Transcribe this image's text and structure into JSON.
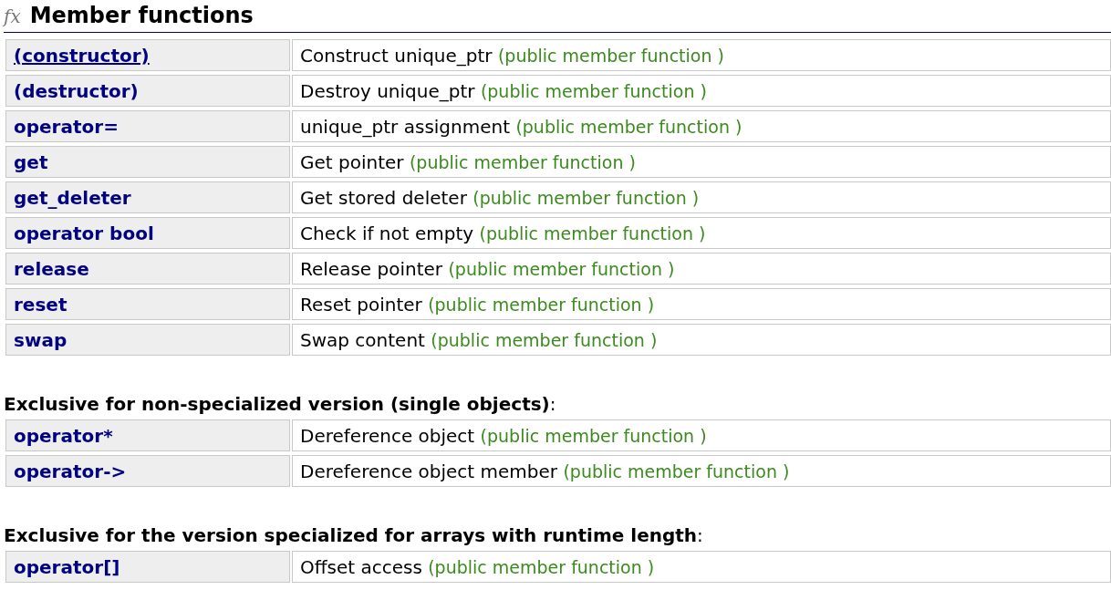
{
  "title_icon": "fx",
  "title": "Member functions",
  "sections": [
    {
      "rows": [
        {
          "name": "(constructor)",
          "underlined": true,
          "description": "Construct unique_ptr",
          "note": "(public member function )"
        },
        {
          "name": "(destructor)",
          "underlined": false,
          "description": "Destroy unique_ptr",
          "note": "(public member function )"
        },
        {
          "name": "operator=",
          "underlined": false,
          "description": "unique_ptr assignment",
          "note": "(public member function )"
        },
        {
          "name": "get",
          "underlined": false,
          "description": "Get pointer",
          "note": "(public member function )"
        },
        {
          "name": "get_deleter",
          "underlined": false,
          "description": "Get stored deleter",
          "note": "(public member function )"
        },
        {
          "name": "operator bool",
          "underlined": false,
          "description": "Check if not empty",
          "note": "(public member function )"
        },
        {
          "name": "release",
          "underlined": false,
          "description": "Release pointer",
          "note": "(public member function )"
        },
        {
          "name": "reset",
          "underlined": false,
          "description": "Reset pointer",
          "note": "(public member function )"
        },
        {
          "name": "swap",
          "underlined": false,
          "description": "Swap content",
          "note": "(public member function )"
        }
      ]
    },
    {
      "heading": "**Exclusive for non-specialized version (single objects)**:",
      "rows": [
        {
          "name": "operator*",
          "underlined": false,
          "description": "Dereference object",
          "note": "(public member function )"
        },
        {
          "name": "operator->",
          "underlined": false,
          "description": "Dereference object member",
          "note": "(public member function )"
        }
      ]
    },
    {
      "heading": "**Exclusive for the version specialized for arrays with runtime length**:",
      "rows": [
        {
          "name": "operator[]",
          "underlined": false,
          "description": "Offset access",
          "note": "(public member function )"
        }
      ]
    }
  ]
}
